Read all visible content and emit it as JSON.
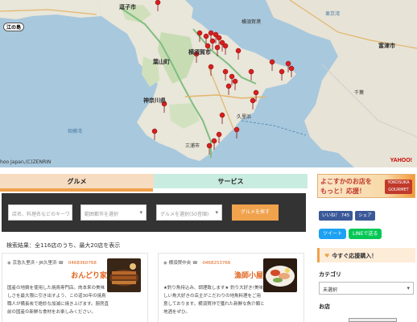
{
  "map": {
    "labels": {
      "zushi": "逗子市",
      "yokosuka_port": "横須賀港",
      "hayama": "葉山町",
      "yokosuka_city": "横須賀市",
      "kanagawa": "神奈川県",
      "sagami_bay": "相模湾",
      "tokyo_bay": "東京湾",
      "enoshima": "江の島",
      "miura": "三浦市",
      "kurihama": "久里浜",
      "futtsu": "富津市",
      "chiba": "千葉",
      "credit": "hoo Japan,(C)ZENRIN",
      "brand": "YAHOO!"
    }
  },
  "tabs": {
    "gourmet": "グルメ",
    "service": "サービス"
  },
  "search": {
    "keyword_placeholder": "店名、料理名などのキーワ",
    "area_select": "範囲都市を選択",
    "genre_select": "グルメを選択(50音順)",
    "button": "グルメを探す"
  },
  "results": {
    "summary": "検索結果：全116店のうち、最大20店を表示"
  },
  "cards": [
    {
      "area": "京急久里浜・JR久里浜",
      "phone": "0468360768",
      "name": "おんどり家",
      "description": "国産の地鶏を使用した焼鳥専門店。肉本来の美味しさを最大限に引き出すよう、この道30年の焼鳥職人が備長炭で絶妙な加減に焼き上げます。厨房直前の国産の新鮮な食材をお楽しみください。"
    },
    {
      "area": "横須賀中央",
      "phone": "0468253766",
      "name": "漁師小屋",
      "description": "★釣り魚持込み、調理致します★ 釣り大好き!美味しい魚大好きの店主がこだわりの地魚料理をご用意しております。横須賀沖で獲れた新鮮な魚介類と地酒をぜひ。"
    }
  ],
  "sidebar": {
    "banner_line1": "よこすかのお店を",
    "banner_line2": "もっと！応援！",
    "banner_logo": "YOKOSUKA GOURMET",
    "like": "いいね！ 745",
    "share": "シェア",
    "tweet": "ツイート",
    "line": "LINEで送る",
    "support": "今すぐ応援購入！",
    "category_heading": "カテゴリ",
    "category_select": "未選択",
    "shop_heading": "お店"
  },
  "colors": {
    "accent_orange": "#f0a24c",
    "tab_gourmet_bg": "#f6dcc0",
    "tab_service_bg": "#c8ecdf",
    "pin_red": "#d81e1e"
  }
}
